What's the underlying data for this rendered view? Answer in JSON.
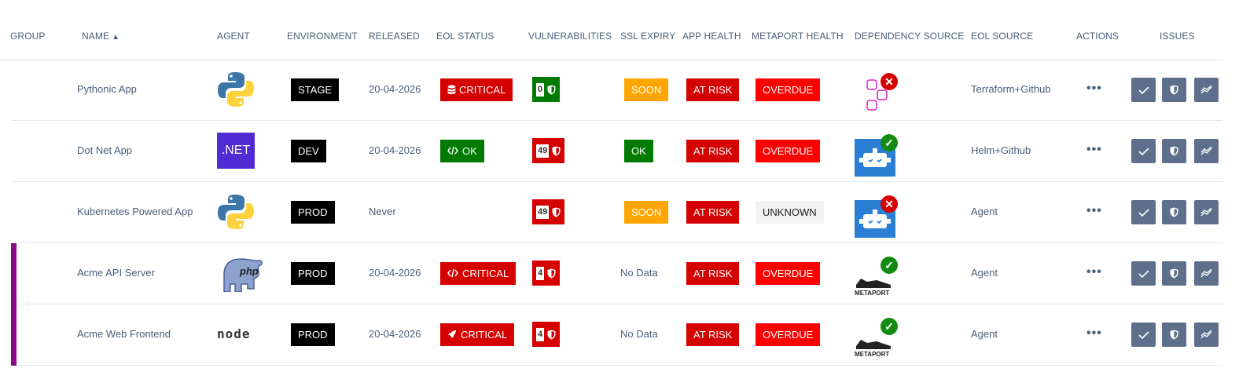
{
  "columns": {
    "group": "GROUP",
    "name": "NAME",
    "agent": "AGENT",
    "environment": "ENVIRONMENT",
    "released": "RELEASED",
    "eol_status": "EOL STATUS",
    "vulnerabilities": "VULNERABILITIES",
    "ssl_expiry": "SSL EXPIRY",
    "app_health": "APP HEALTH",
    "metaport_health": "METAPORT HEALTH",
    "dependency_source": "DEPENDENCY SOURCE",
    "eol_source": "EOL SOURCE",
    "actions": "ACTIONS",
    "issues": "ISSUES"
  },
  "sort_icon": "sort-icon",
  "colors": {
    "group_purple": "#8b0a8b",
    "critical_red": "#d50000",
    "overdue_red": "#ff0000",
    "ok_green": "#007a00",
    "soon_orange": "#ffa500",
    "issue_button": "#5d6f8b"
  },
  "rows": [
    {
      "name": "Pythonic App",
      "agent": "python-logo",
      "environment": "STAGE",
      "released": "20-04-2026",
      "eol": {
        "icon": "database-icon",
        "label": "CRITICAL",
        "color": "#d50000"
      },
      "vuln_count": "0",
      "vuln_color": "#007a00",
      "ssl": "SOON",
      "app_health": "AT RISK",
      "metaport": "OVERDUE",
      "dependency": {
        "icon": "dependency-graph-icon",
        "status": "error"
      },
      "eol_source": "Terraform+Github",
      "actions": "•••"
    },
    {
      "name": "Dot Net App",
      "agent": "dotnet-logo",
      "agent_text": ".NET",
      "environment": "DEV",
      "released": "20-04-2026",
      "eol": {
        "icon": "code-icon",
        "label": "OK",
        "color": "#007a00"
      },
      "vuln_count": "49",
      "vuln_color": "#d50000",
      "ssl": "OK",
      "app_health": "AT RISK",
      "metaport": "OVERDUE",
      "dependency": {
        "icon": "renovate-bot-icon",
        "status": "ok"
      },
      "eol_source": "Helm+Github",
      "actions": "•••"
    },
    {
      "name": "Kubernetes Powered App",
      "agent": "python-logo",
      "environment": "PROD",
      "released": "Never",
      "eol": null,
      "vuln_count": "49",
      "vuln_color": "#d50000",
      "ssl": "SOON",
      "app_health": "AT RISK",
      "metaport": "UNKNOWN",
      "dependency": {
        "icon": "renovate-bot-icon",
        "status": "error"
      },
      "eol_source": "Agent",
      "actions": "•••"
    },
    {
      "name": "Acme API Server",
      "agent": "php-logo",
      "agent_text": "php",
      "environment": "PROD",
      "released": "20-04-2026",
      "eol": {
        "icon": "code-icon",
        "label": "CRITICAL",
        "color": "#d50000"
      },
      "vuln_count": "4",
      "vuln_color": "#d50000",
      "ssl": "No Data",
      "app_health": "AT RISK",
      "metaport": "OVERDUE",
      "dependency": {
        "icon": "metaport-logo",
        "status": "ok",
        "label": "METAPORT"
      },
      "eol_source": "Agent",
      "actions": "•••",
      "group_color": "#8b0a8b"
    },
    {
      "name": "Acme Web Frontend",
      "agent": "nodejs-logo",
      "agent_text": "node",
      "environment": "PROD",
      "released": "20-04-2026",
      "eol": {
        "icon": "rocket-icon",
        "label": "CRITICAL",
        "color": "#d50000"
      },
      "vuln_count": "4",
      "vuln_color": "#d50000",
      "ssl": "No Data",
      "app_health": "AT RISK",
      "metaport": "OVERDUE",
      "dependency": {
        "icon": "metaport-logo",
        "status": "ok",
        "label": "METAPORT"
      },
      "eol_source": "Agent",
      "actions": "•••",
      "group_color": "#8b0a8b"
    }
  ]
}
